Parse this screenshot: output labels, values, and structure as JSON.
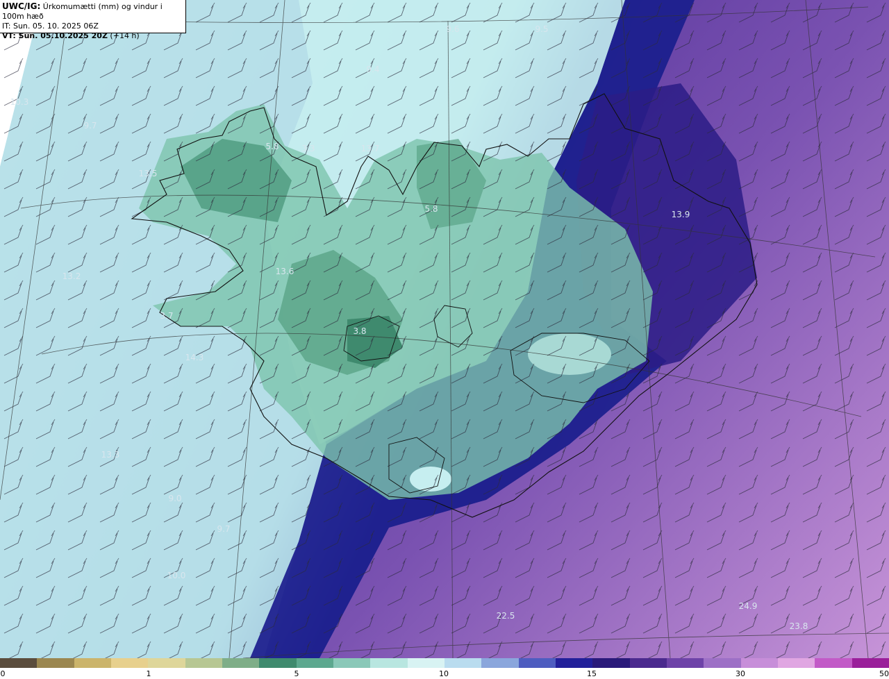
{
  "header": {
    "title_bold": "UWC/IG:",
    "title_rest": " Úrkomumætti (mm) og vindur i 100m hæð",
    "it_line": "IT: Sun. 05. 10. 2025 06Z",
    "vt_bold": "VT: Sun. 05.10.2025 20Z",
    "vt_rest": " (+14 h)"
  },
  "map": {
    "value_labels": [
      "9.6",
      "9.5",
      "9.4",
      "10.3",
      "9.7",
      "5.8",
      "3.3",
      "13.7",
      "13.5",
      "5.8",
      "13.9",
      "13.6",
      "13.2",
      "3.7",
      "3.8",
      "14.3",
      "13.3",
      "9.0",
      "9.7",
      "10.0",
      "22.5",
      "24.9",
      "23.8"
    ],
    "colors": {
      "light_cyan": "#c7f0f0",
      "sea_green": "#6fb79e",
      "land_green": "#3f8a6e",
      "navy": "#1d1f8e",
      "indigo": "#3b1f8a",
      "purple": "#7c4bb0",
      "lavender": "#a67fcf",
      "pink": "#c893d9"
    }
  },
  "legend": {
    "ticks": [
      "0",
      "1",
      "5",
      "10",
      "15",
      "30",
      "50"
    ],
    "colors": [
      "#5b4d3d",
      "#9b8750",
      "#cbb46b",
      "#e7d08d",
      "#ded69a",
      "#b7c793",
      "#7fae88",
      "#3f8a6e",
      "#5da88f",
      "#8ac8b8",
      "#b8e6e0",
      "#d8f3f3",
      "#b9dcef",
      "#8aa6dc",
      "#4e5dc0",
      "#22209a",
      "#2a1a7a",
      "#4b2a8e",
      "#6e43a8",
      "#9d70c6",
      "#c78ed9",
      "#e0a6e2",
      "#c25ac7",
      "#9a1f9a"
    ]
  }
}
